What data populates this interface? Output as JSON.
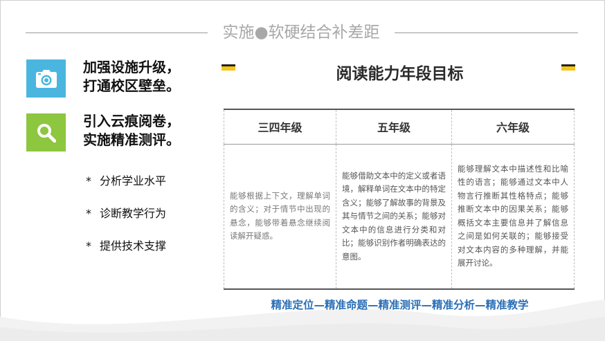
{
  "slide": {
    "title": "实施●软硬结合补差距",
    "features": [
      {
        "icon": "camera-icon",
        "line1": "加强设施升级，",
        "line2": "打通校区壁垒。",
        "color": "#4ab6e0"
      },
      {
        "icon": "search-icon",
        "line1": "引入云痕阅卷，",
        "line2": "实施精准测评。",
        "color": "#8dc63f"
      }
    ],
    "bullets": [
      {
        "star": "*",
        "text": "分析学业水平"
      },
      {
        "star": "*",
        "text": "诊断教学行为"
      },
      {
        "star": "*",
        "text": "提供技术支撑"
      }
    ]
  },
  "table": {
    "title": "阅读能力年段目标",
    "headers": [
      "三四年级",
      "五年级",
      "六年级"
    ],
    "cells": [
      "能够根据上下文，理解单词的含义；对于情节中出现的悬念，能够带着悬念继续阅读解开疑惑。",
      "能够借助文本中的定义或者语境，解释单词在文本中的特定含义；能够了解故事的背景及其与情节之间的关系；能够对文本中的信息进行分类和对比；能够识别作者明确表达的意图。",
      "能够理解文本中描述性和比喻性的语言；能够通过文本中人物言行推断其性格特点；能够推断文本中的因果关系；能够概括文本主要信息并了解信息之间是如何关联的；能够接受对文本内容的多种理解，并能展开讨论。"
    ]
  },
  "footer": {
    "chain": "精准定位—精准命题—精准测评—精准分析—精准教学"
  },
  "colors": {
    "accent_blue": "#4ab6e0",
    "accent_green": "#8dc63f",
    "tab_yellow": "#f6c517",
    "footer_blue": "#2a6fb6"
  }
}
